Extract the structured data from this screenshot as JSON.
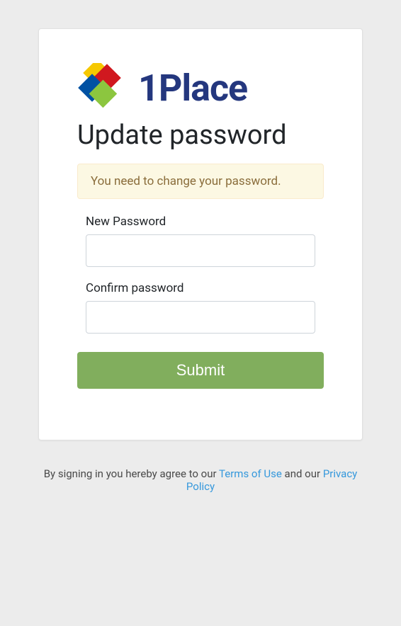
{
  "logo": {
    "text": "1Place",
    "colors": {
      "yellow": "#f6c800",
      "red": "#d0181f",
      "blue": "#0051a3",
      "green": "#8cc63f"
    }
  },
  "page": {
    "title": "Update password"
  },
  "alert": {
    "message": "You need to change your password."
  },
  "form": {
    "new_password_label": "New Password",
    "confirm_password_label": "Confirm password",
    "submit_label": "Submit"
  },
  "footer": {
    "prefix": "By signing in you hereby agree to our ",
    "terms_link": "Terms of Use",
    "middle": " and our ",
    "privacy_link": "Privacy Policy"
  }
}
